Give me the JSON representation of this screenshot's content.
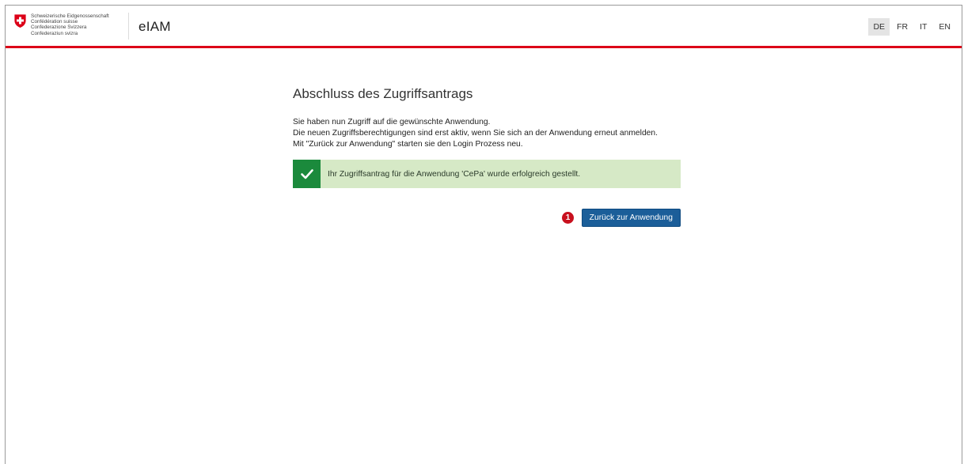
{
  "header": {
    "confederation_lines": [
      "Schweizerische Eidgenossenschaft",
      "Confédération suisse",
      "Confederazione Svizzera",
      "Confederaziun svizra"
    ],
    "app_title": "eIAM",
    "languages": [
      "DE",
      "FR",
      "IT",
      "EN"
    ],
    "active_language": "DE"
  },
  "main": {
    "title": "Abschluss des Zugriffsantrags",
    "paragraphs": [
      "Sie haben nun Zugriff auf die gewünschte Anwendung.",
      "Die neuen Zugriffsberechtigungen sind erst aktiv, wenn Sie sich an der Anwendung erneut anmelden.",
      "Mit \"Zurück zur Anwendung\" starten sie den Login Prozess neu."
    ],
    "success_message": "Ihr Zugriffsantrag für die Anwendung 'CePa' wurde erfolgreich gestellt.",
    "step_badge": "1",
    "back_button_label": "Zurück zur Anwendung"
  },
  "colors": {
    "accent_red": "#dc0018",
    "success_bg": "#d6e9c6",
    "success_icon": "#1b8a3c",
    "button_blue": "#1b5e99"
  }
}
